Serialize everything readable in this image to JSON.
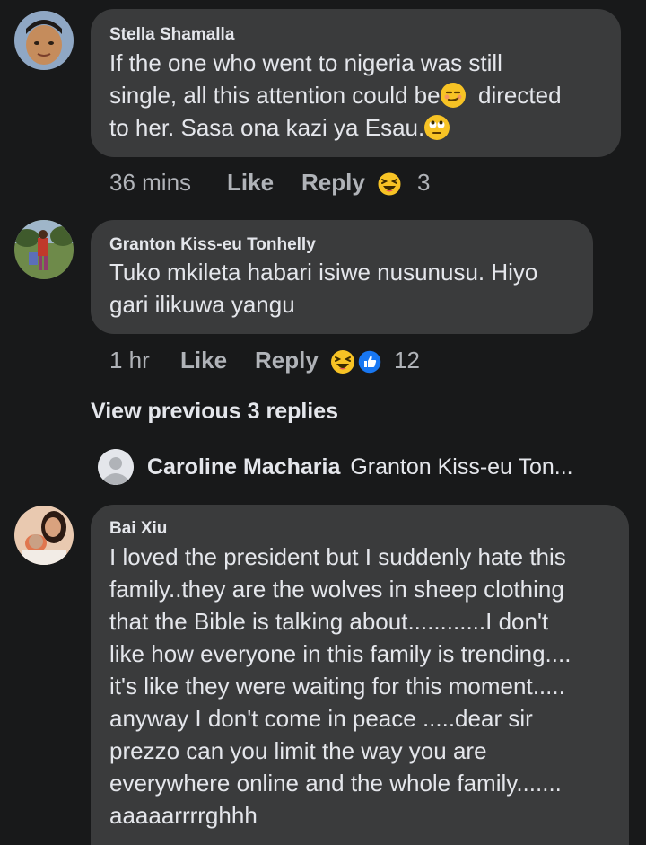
{
  "comments": [
    {
      "author": "Stella Shamalla",
      "lines": [
        "If the one who went to nigeria was still",
        "single, all this attention could be",
        "directed",
        "to her. Sasa ona kazi ya Esau."
      ],
      "time": "36 mins",
      "like_label": "Like",
      "reply_label": "Reply",
      "reaction_count": "3"
    },
    {
      "author": "Granton Kiss-eu Tonhelly",
      "lines": [
        "Tuko mkileta habari isiwe nusunusu. Hiyo",
        "gari ilikuwa yangu"
      ],
      "time": "1 hr",
      "like_label": "Like",
      "reply_label": "Reply",
      "reaction_count": "12"
    },
    {
      "author": "Bai Xiu",
      "lines": [
        "I loved the president but I suddenly hate this",
        "family..they are the wolves in sheep clothing",
        "that the Bible is talking about............I don't",
        "like how everyone in this family is trending....",
        "it's like they were waiting for this moment.....",
        "anyway I don't come in peace .....dear sir",
        "prezzo can you limit the way you are",
        "everywhere online and the whole family.......",
        "aaaaarrrrghhh"
      ]
    }
  ],
  "view_previous": "View previous 3 replies",
  "latest_reply": {
    "author": "Caroline Macharia",
    "preview": "Granton Kiss-eu Ton..."
  },
  "icons": {
    "smirk": "smirk-emoji-icon",
    "eyeroll": "eye-roll-emoji-icon",
    "haha": "haha-reaction-icon",
    "like": "like-reaction-icon",
    "default_avatar": "default-avatar-icon"
  },
  "colors": {
    "background": "#18191a",
    "bubble": "#3a3b3c",
    "text": "#e4e6eb",
    "secondary": "#b0b3b8",
    "like_blue": "#1877f2",
    "emoji_yellow": "#f7c325"
  }
}
